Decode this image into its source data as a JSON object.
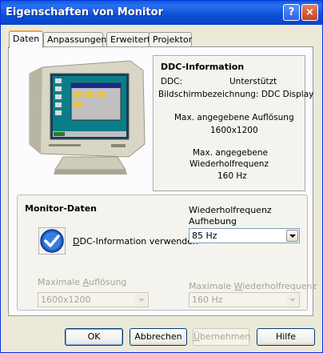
{
  "window": {
    "title": "Eigenschaften von Monitor",
    "help_label": "?",
    "close_label": "×"
  },
  "tabs": [
    {
      "label": "Daten"
    },
    {
      "label": "Anpassungen"
    },
    {
      "label": "Erweitert"
    },
    {
      "label": "Projektor"
    }
  ],
  "ddc": {
    "title": "DDC-Information",
    "ddc_label": "DDC:",
    "ddc_value": "Unterstützt",
    "name_line": "Bildschirmbezeichnung: DDC Display",
    "max_res_label": "Max. angegebene Auflösung",
    "max_res_value": "1600x1200",
    "max_freq_label_1": "Max. angegebene",
    "max_freq_label_2": "Wiederholfrequenz",
    "max_freq_value": "160 Hz"
  },
  "monitor_data": {
    "title": "Monitor-Daten",
    "use_ddc_label_underlined": "D",
    "use_ddc_label_rest": "DC-Information verwenden",
    "refresh_override_label_1": "Wiederholfrequenz",
    "refresh_override_label_2": "Aufhebung",
    "refresh_override_value": "85 Hz",
    "max_res_label_pre": "Maximale ",
    "max_res_label_ul": "A",
    "max_res_label_post": "uflösung",
    "max_res_value": "1600x1200",
    "max_freq_label_pre": "Maximale ",
    "max_freq_label_ul": "W",
    "max_freq_label_post": "iederholfrequenz",
    "max_freq_value": "160 Hz"
  },
  "buttons": {
    "ok": "OK",
    "cancel": "Abbrechen",
    "apply_ul": "Ü",
    "apply_rest": "bernehmen",
    "help": "Hilfe"
  }
}
